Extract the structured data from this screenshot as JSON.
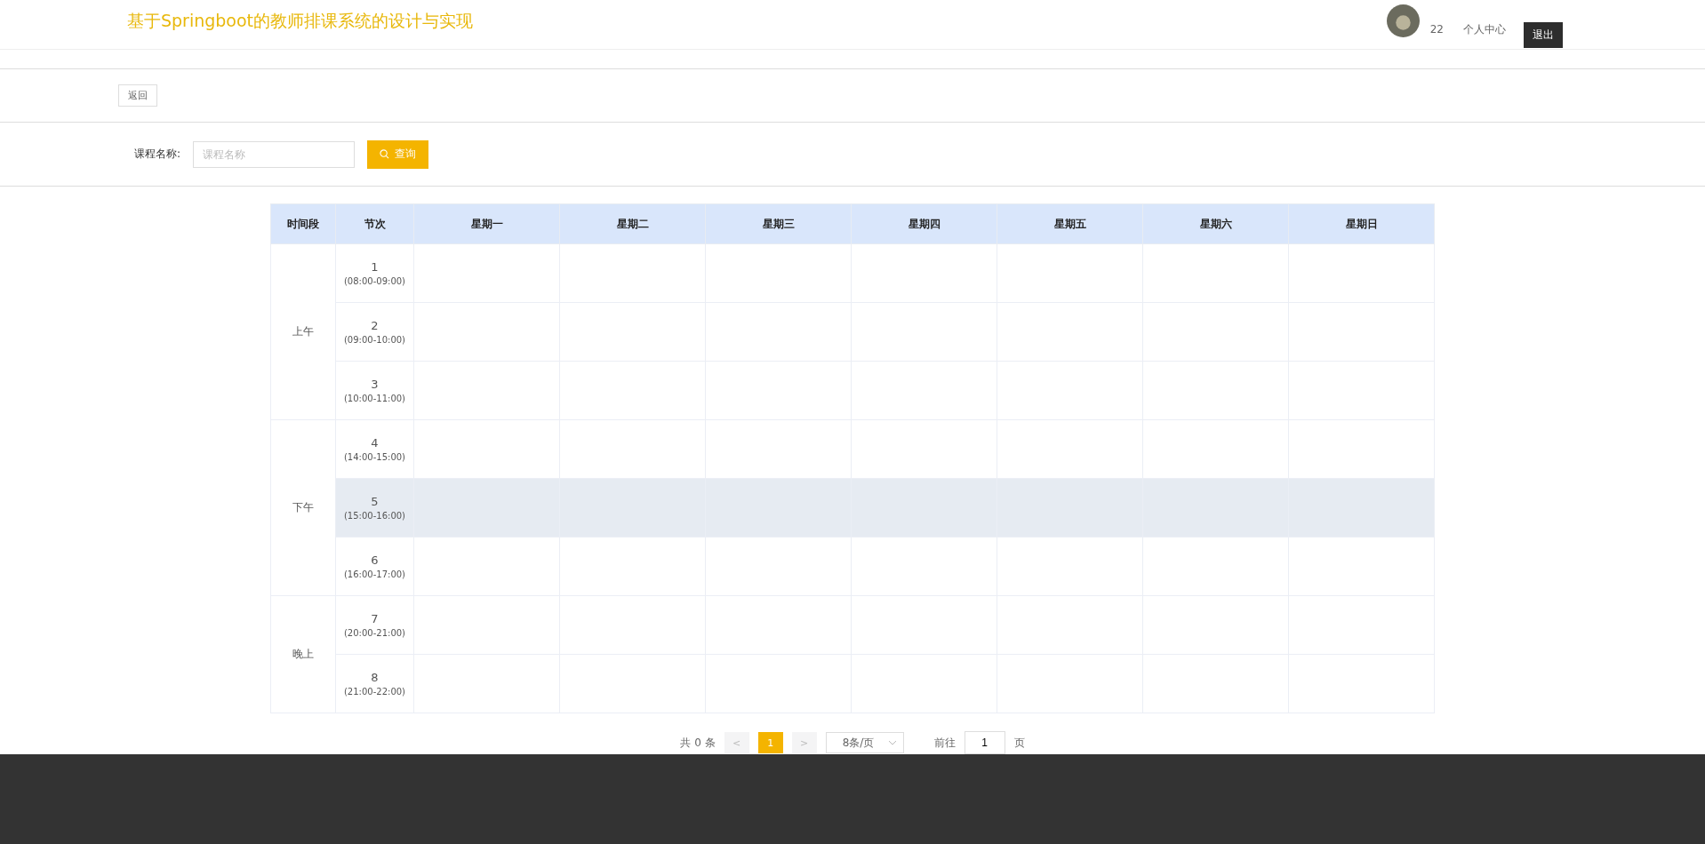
{
  "header": {
    "title": "基于Springboot的教师排课系统的设计与实现",
    "username": "22",
    "profile_link": "个人中心",
    "logout": "退出"
  },
  "toolbar": {
    "back": "返回"
  },
  "search": {
    "label": "课程名称:",
    "placeholder": "课程名称",
    "button": "查询"
  },
  "table": {
    "columns": [
      "时间段",
      "节次",
      "星期一",
      "星期二",
      "星期三",
      "星期四",
      "星期五",
      "星期六",
      "星期日"
    ],
    "groups": [
      {
        "label": "上午",
        "periods": [
          {
            "number": "1",
            "time": "(08:00-09:00)",
            "highlighted": false
          },
          {
            "number": "2",
            "time": "(09:00-10:00)",
            "highlighted": false
          },
          {
            "number": "3",
            "time": "(10:00-11:00)",
            "highlighted": false
          }
        ]
      },
      {
        "label": "下午",
        "periods": [
          {
            "number": "4",
            "time": "(14:00-15:00)",
            "highlighted": false
          },
          {
            "number": "5",
            "time": "(15:00-16:00)",
            "highlighted": true
          },
          {
            "number": "6",
            "time": "(16:00-17:00)",
            "highlighted": false
          }
        ]
      },
      {
        "label": "晚上",
        "periods": [
          {
            "number": "7",
            "time": "(20:00-21:00)",
            "highlighted": false
          },
          {
            "number": "8",
            "time": "(21:00-22:00)",
            "highlighted": false
          }
        ]
      }
    ]
  },
  "pagination": {
    "total": "共 0 条",
    "prev": "<",
    "pages": [
      {
        "label": "1",
        "selected": true
      }
    ],
    "next": ">",
    "page_size": "8条/页",
    "goto_label": "前往",
    "goto_value": "1",
    "goto_suffix": "页"
  }
}
